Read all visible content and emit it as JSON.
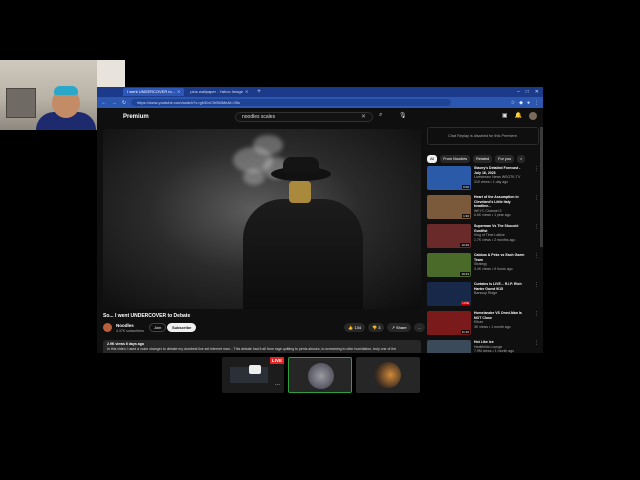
{
  "browser": {
    "tabs": [
      {
        "label": "I went UNDERCOVER to..."
      },
      {
        "label": "plus wallpaper - Yahoo Image"
      }
    ],
    "new_tab": "+",
    "url": "https://www.youtube.com/watch?v=gNDnC9r5MMe&t=39s",
    "window_controls": {
      "minimize": "–",
      "maximize": "□",
      "close": "✕"
    }
  },
  "youtube": {
    "logo": "Premium",
    "search_value": "noodles scales",
    "video": {
      "title": "So... I went UNDERCOVER to Debate",
      "channel": "Noodles",
      "subscribers": "4.37K subscribers",
      "join": "Join",
      "subscribe": "Subscribe",
      "likes": "134",
      "dislikes": "3",
      "share": "Share",
      "more": "...",
      "description_meta": "2.9K views  6 days ago",
      "description": "In this video I used a voice changer to debate my dumbest live set internet man... This debate had it all from rage quitting to penis abuses, to screaming to utter humiliation, truly one of the"
    },
    "sidebar": {
      "chat_disabled": "Chat Replay is disabled for this Premiere.",
      "chips": [
        "All",
        "From Noodles",
        "Related",
        "For you",
        ">"
      ],
      "recommendations": [
        {
          "title": "Stacey's Detailed Forecast - July 16, 2023",
          "channel": "Livestream News WSGTK-TV",
          "meta": "310 views • 1 day ago",
          "duration": "0:00",
          "color": "#2a5aa8"
        },
        {
          "title": "Heart of the Assumption in Cleveland's Little Italy headline...",
          "channel": "WKYC Channel 3",
          "meta": "6.6K views • 1 year ago",
          "duration": "1:30",
          "color": "#7a5a3a"
        },
        {
          "title": "Superman Vs The Shocoid Guntfist",
          "channel": "King of Time Lattice",
          "meta": "1.7K views • 2 months ago",
          "duration": "10:29",
          "color": "#6b2a2a"
        },
        {
          "title": "Cabbus & Pekx vs Each Gaem Team",
          "channel": "Strategy",
          "meta": "3.4K views • 9 hours ago",
          "duration": "19:43",
          "color": "#4a6a2a"
        },
        {
          "title": "Curtains is LIVE... R.I.P. Rich Harter Guest 9/15",
          "channel": "Barsoup Ridge",
          "meta": "",
          "duration": "LIVE",
          "color": "#182848"
        },
        {
          "title": "Homelander VS Omni-Man Is NOT Close",
          "channel": "Ethan",
          "meta": "3K views • 1 month ago",
          "duration": "11:26",
          "color": "#7a1a1a"
        },
        {
          "title": "Hot Like Ice",
          "channel": "Heatfields Lounge",
          "meta": "7.9M views • 1 month ago",
          "duration": "3:29",
          "color": "#3a4a5a"
        }
      ]
    }
  },
  "stream_tray": {
    "live_label": "LIVE",
    "more": "..."
  }
}
